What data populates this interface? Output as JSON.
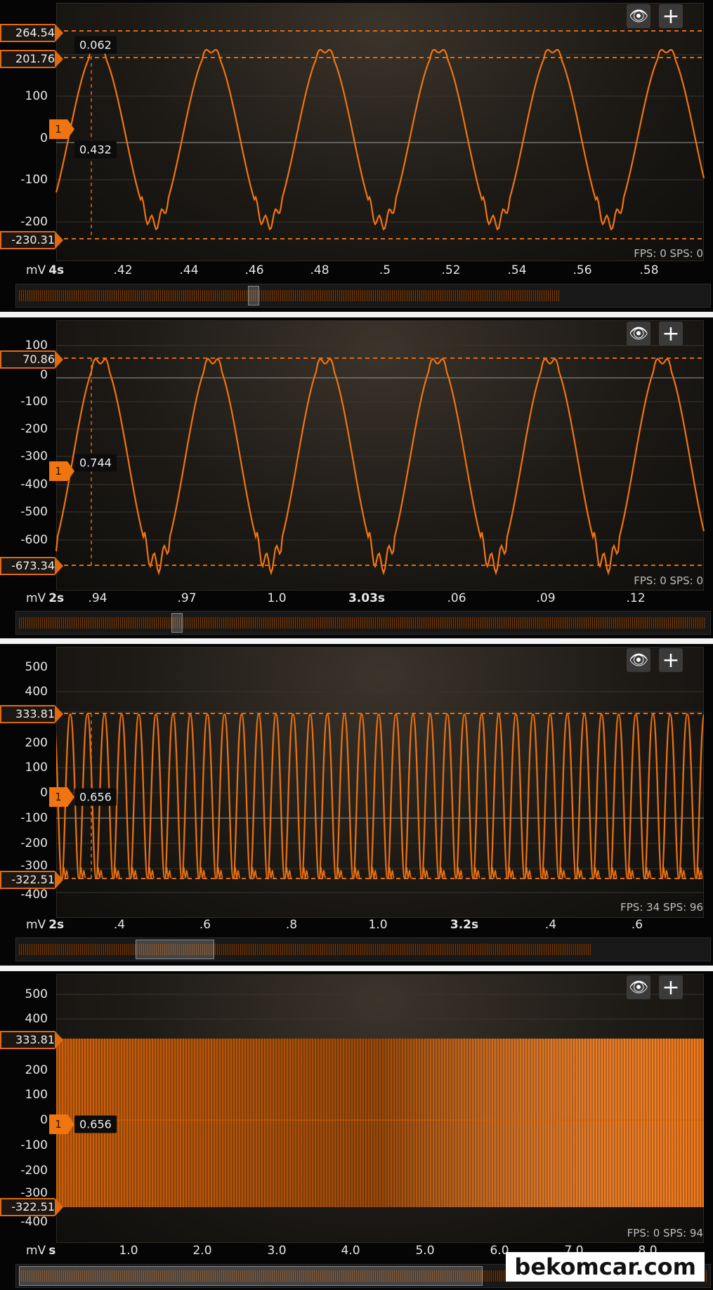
{
  "buttons": {
    "eye_icon": "eye-icon",
    "plus_icon": "plus-icon"
  },
  "colors": {
    "trace": "#f07410",
    "cursor": "#e06a10",
    "background": "#1d1a16"
  },
  "panels": [
    {
      "y_ticks": [
        "100",
        "0",
        "-100",
        "-200"
      ],
      "cursor_labels": {
        "top": "264.54",
        "mid": "201.76",
        "bottom": "-230.31"
      },
      "channel": "1",
      "tooltips": [
        "0.062",
        "0.432"
      ],
      "x_unit": "mV",
      "x_scale": "4s",
      "x_ticks": [
        ".42",
        ".44",
        ".46",
        ".48",
        ".5",
        ".52",
        ".54",
        ".56",
        ".58"
      ],
      "fps_text": "FPS: 0  SPS: 0"
    },
    {
      "y_ticks": [
        "100",
        "0",
        "-100",
        "-200",
        "-300",
        "-400",
        "-500",
        "-600"
      ],
      "cursor_labels": {
        "top": "70.86",
        "bottom": "-673.34"
      },
      "channel": "1",
      "tooltips": [
        "0.744"
      ],
      "x_unit": "mV",
      "x_scale": "2s",
      "x_ticks": [
        ".94",
        ".97",
        "1.0",
        "3.03s",
        ".06",
        ".09",
        ".12"
      ],
      "fps_text": "FPS: 0  SPS: 0"
    },
    {
      "y_ticks": [
        "500",
        "400",
        "200",
        "100",
        "0",
        "-100",
        "-200",
        "-300",
        "-400"
      ],
      "cursor_labels": {
        "top": "333.81",
        "bottom": "-322.51"
      },
      "channel": "1",
      "tooltips": [
        "0.656"
      ],
      "x_unit": "mV",
      "x_scale": "2s",
      "x_ticks": [
        ".4",
        ".6",
        ".8",
        "1.0",
        "3.2s",
        ".4",
        ".6"
      ],
      "fps_text": "FPS: 34  SPS: 96"
    },
    {
      "y_ticks": [
        "500",
        "400",
        "200",
        "100",
        "0",
        "-100",
        "-200",
        "-300",
        "-400"
      ],
      "cursor_labels": {
        "top": "333.81",
        "bottom": "-322.51"
      },
      "channel": "1",
      "tooltips": [
        "0.656"
      ],
      "x_unit": "mV",
      "x_scale": "s",
      "x_ticks": [
        "1.0",
        "2.0",
        "3.0",
        "4.0",
        "5.0",
        "6.0",
        "7.0",
        "8.0"
      ],
      "fps_text": "FPS: 0  SPS: 94"
    }
  ],
  "watermark": "bekomcar.com"
}
